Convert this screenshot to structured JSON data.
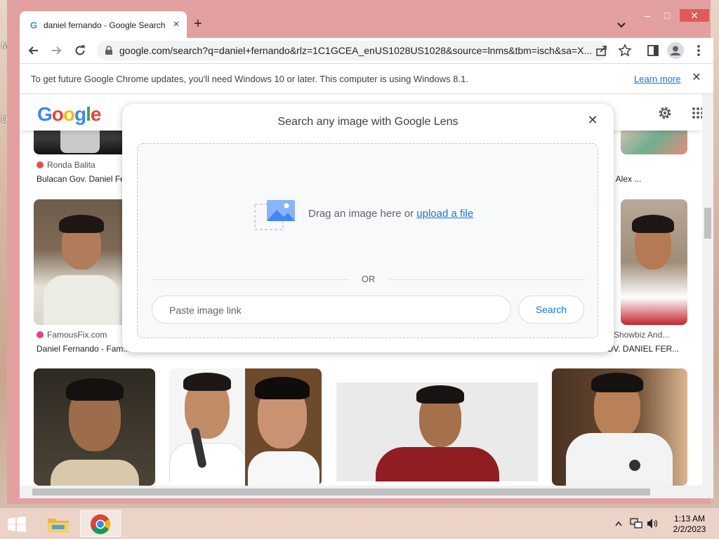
{
  "desktop": {
    "letters": [
      "M",
      "D"
    ]
  },
  "browser": {
    "tab": {
      "title": "daniel fernando - Google Search",
      "close": "×"
    },
    "new_tab": "+",
    "window_controls": {
      "minimize": "–",
      "maximize": "□",
      "close": "✕"
    },
    "url": "google.com/search?q=daniel+fernando&rlz=1C1GCEA_enUS1028US1028&source=lnms&tbm=isch&sa=X...",
    "infobar": {
      "message": "To get future Google Chrome updates, you'll need Windows 10 or later. This computer is using Windows 8.1.",
      "learn_more": "Learn more",
      "close": "✕"
    }
  },
  "google": {
    "logo": [
      "G",
      "o",
      "o",
      "g",
      "l",
      "e"
    ],
    "logo_colors": [
      "#4285F4",
      "#EA4335",
      "#FBBC05",
      "#4285F4",
      "#34A853",
      "#EA4335"
    ]
  },
  "results": {
    "row1": {
      "left_source": "Ronda Balita",
      "left_title": "Bulacan Gov. Daniel Fe...",
      "right_title": "M Alex ..."
    },
    "row2": {
      "left_source": "FamousFix.com",
      "left_title": "Daniel Fernando - Fam...",
      "right_source": "a Showbiz And...",
      "right_title": "OV. DANIEL FER..."
    }
  },
  "lens": {
    "title": "Search any image with Google Lens",
    "close": "✕",
    "drag_text": "Drag an image here or",
    "upload_link": "upload a file",
    "or_label": "OR",
    "paste_placeholder": "Paste image link",
    "search_button": "Search"
  },
  "taskbar": {
    "time": "1:13 AM",
    "date": "2/2/2023"
  },
  "colors": {
    "window_frame": "#e3a0a0",
    "link_blue": "#1a73e8",
    "ronda_balita_icon": "#e0514e",
    "famousfix_icon": "#e83e8c"
  }
}
